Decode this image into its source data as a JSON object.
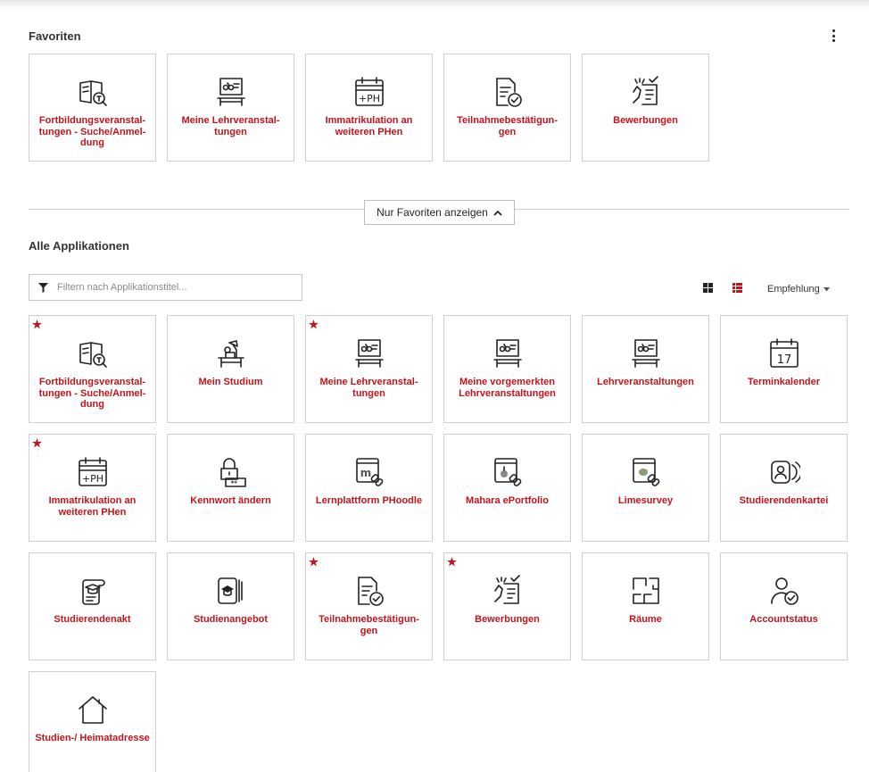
{
  "favorites": {
    "title": "Favoriten",
    "items": [
      {
        "label": "Fortbildungsveranstal-tungen - Suche/Anmel-dung",
        "icon": "book-search-icon"
      },
      {
        "label": "Meine Lehrveranstal-tungen",
        "icon": "lectern-board-icon"
      },
      {
        "label": "Immatrikulation an weiteren PHen",
        "icon": "calendar-ph-icon"
      },
      {
        "label": "Teilnahmebestätigun-gen",
        "icon": "document-check-icon"
      },
      {
        "label": "Bewerbungen",
        "icon": "hand-document-icon"
      }
    ]
  },
  "toggle": {
    "label": "Nur Favoriten anzeigen"
  },
  "all_apps": {
    "title": "Alle Applikationen",
    "filter_placeholder": "Filtern nach Applikationstitel...",
    "sort_label": "Empfehlung",
    "accent_color": "#c4141b",
    "items": [
      {
        "label": "Fortbildungsveranstal-tungen - Suche/Anmel-dung",
        "icon": "book-search-icon",
        "favorite": true
      },
      {
        "label": "Mein Studium",
        "icon": "desk-lamp-icon",
        "favorite": false
      },
      {
        "label": "Meine Lehrveranstal-tungen",
        "icon": "lectern-board-icon",
        "favorite": true
      },
      {
        "label": "Meine vorgemerkten Lehrveranstaltungen",
        "icon": "lectern-board-icon",
        "favorite": false
      },
      {
        "label": "Lehrveranstaltungen",
        "icon": "lectern-board-icon",
        "favorite": false
      },
      {
        "label": "Terminkalender",
        "icon": "calendar-17-icon",
        "calendar_day": "17",
        "favorite": false
      },
      {
        "label": "Immatrikulation an weiteren PHen",
        "icon": "calendar-ph-icon",
        "favorite": true
      },
      {
        "label": "Kennwort ändern",
        "icon": "lock-password-icon",
        "favorite": false
      },
      {
        "label": "Lernplattform PHoodle",
        "icon": "moodle-link-icon",
        "favorite": false
      },
      {
        "label": "Mahara ePortfolio",
        "icon": "mahara-link-icon",
        "favorite": false
      },
      {
        "label": "Limesurvey",
        "icon": "limesurvey-link-icon",
        "favorite": false
      },
      {
        "label": "Studierendenkartei",
        "icon": "contactless-id-icon",
        "favorite": false
      },
      {
        "label": "Studierendenakt",
        "icon": "scroll-cap-icon",
        "favorite": false
      },
      {
        "label": "Studienangebot",
        "icon": "book-cap-icon",
        "favorite": false
      },
      {
        "label": "Teilnahmebestätigun-gen",
        "icon": "document-check-icon",
        "favorite": true
      },
      {
        "label": "Bewerbungen",
        "icon": "hand-document-icon",
        "favorite": true
      },
      {
        "label": "Räume",
        "icon": "floorplan-icon",
        "favorite": false
      },
      {
        "label": "Accountstatus",
        "icon": "user-check-icon",
        "favorite": false
      },
      {
        "label": "Studien-/ Heimatadresse",
        "icon": "house-icon",
        "favorite": false
      }
    ]
  }
}
